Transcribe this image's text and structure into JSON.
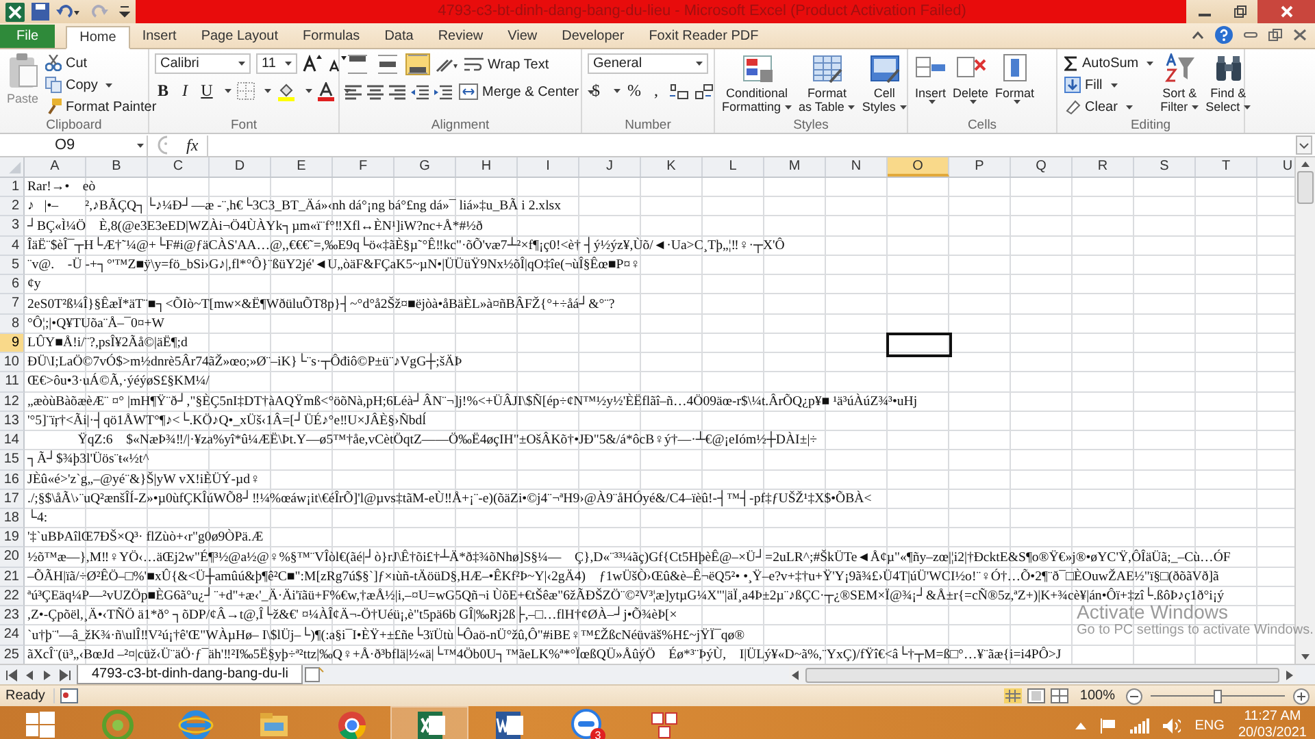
{
  "window": {
    "title": "4793-c3-bt-dinh-dang-bang-du-lieu  -  Microsoft Excel (Product Activation Failed)"
  },
  "ribbon_tabs": [
    {
      "label": "File",
      "kind": "file",
      "selected": false
    },
    {
      "label": "Home",
      "kind": "tab",
      "selected": true
    },
    {
      "label": "Insert",
      "kind": "tab",
      "selected": false
    },
    {
      "label": "Page Layout",
      "kind": "tab",
      "selected": false
    },
    {
      "label": "Formulas",
      "kind": "tab",
      "selected": false
    },
    {
      "label": "Data",
      "kind": "tab",
      "selected": false
    },
    {
      "label": "Review",
      "kind": "tab",
      "selected": false
    },
    {
      "label": "View",
      "kind": "tab",
      "selected": false
    },
    {
      "label": "Developer",
      "kind": "tab",
      "selected": false
    },
    {
      "label": "Foxit Reader PDF",
      "kind": "tab",
      "selected": false
    }
  ],
  "clipboard": {
    "label": "Clipboard",
    "paste": "Paste",
    "cut": "Cut",
    "copy": "Copy",
    "format_painter": "Format Painter"
  },
  "font": {
    "label": "Font",
    "name": "Calibri",
    "size": "11",
    "bold": "B",
    "italic": "I",
    "underline": "U"
  },
  "alignment": {
    "label": "Alignment",
    "wrap_text": "Wrap Text",
    "merge_center": "Merge & Center",
    "vertical_align": [
      {
        "selected": false
      },
      {
        "selected": false
      },
      {
        "selected": true
      }
    ]
  },
  "number": {
    "label": "Number",
    "format": "General",
    "currency": "$",
    "percent": "%",
    "comma": ","
  },
  "styles": {
    "label": "Styles",
    "buttons": [
      {
        "line1": "Conditional",
        "line2": "Formatting"
      },
      {
        "line1": "Format",
        "line2": "as Table"
      },
      {
        "line1": "Cell",
        "line2": "Styles"
      }
    ]
  },
  "cells": {
    "label": "Cells",
    "buttons": [
      "Insert",
      "Delete",
      "Format"
    ]
  },
  "editing": {
    "label": "Editing",
    "autosum": "AutoSum",
    "fill": "Fill",
    "clear": "Clear",
    "sort_filter": {
      "line1": "Sort &",
      "line2": "Filter"
    },
    "find_select": {
      "line1": "Find &",
      "line2": "Select"
    }
  },
  "formula_bar": {
    "name_box": "O9",
    "function_label": "fx"
  },
  "columns": [
    {
      "label": "A",
      "selected": false
    },
    {
      "label": "B",
      "selected": false
    },
    {
      "label": "C",
      "selected": false
    },
    {
      "label": "D",
      "selected": false
    },
    {
      "label": "E",
      "selected": false
    },
    {
      "label": "F",
      "selected": false
    },
    {
      "label": "G",
      "selected": false
    },
    {
      "label": "H",
      "selected": false
    },
    {
      "label": "I",
      "selected": false
    },
    {
      "label": "J",
      "selected": false
    },
    {
      "label": "K",
      "selected": false
    },
    {
      "label": "L",
      "selected": false
    },
    {
      "label": "M",
      "selected": false
    },
    {
      "label": "N",
      "selected": false
    },
    {
      "label": "O",
      "selected": true
    },
    {
      "label": "P",
      "selected": false
    },
    {
      "label": "Q",
      "selected": false
    },
    {
      "label": "R",
      "selected": false
    },
    {
      "label": "S",
      "selected": false
    },
    {
      "label": "T",
      "selected": false
    },
    {
      "label": "U",
      "selected": false
    }
  ],
  "rows": [
    {
      "number": "1",
      "selected": false,
      "text": "Rar!→•    eò"
    },
    {
      "number": "2",
      "selected": false,
      "text": "♪   |•–        ²,♪BÃÇQ┐└♪¼Ð┘—æ -¨,h€└3C3_BT_Äá»‹nh dá°¡ng bá°£ng dá»¯ liá»‡u_BÃ i 2.xlsx"
    },
    {
      "number": "3",
      "selected": false,
      "text": "┘BÇ«Ì¼Ö    È,8(@e3E3eED|WZÀi¬Ö4ÙÀYk┐µm«ï¨f°‼Xfl↔ÈN¹]iW?nc+Å*#½ð"
    },
    {
      "number": "4",
      "selected": false,
      "text": "ÎäË¨$èÎ¯┬H└Æ†˜¼@+└F#i@ƒäCÀS'AA…@,,€€€˜=,‰E9q└ö«‡ãÈ§µ˜°Ê‼kc\"·õÕ'væ7┴²×f¶¡ç0!<è† ┤ý½ýz¥,Ùõ/◄·Ua>C¸Tþ„¦‼♀·┬X'Ô"
    },
    {
      "number": "5",
      "selected": false,
      "text": "¨v@.    -Ü -+┐°'™Z■ÿ\\y=fö_bSi›G♪|,fl*°Ô}¨ßüY2jé'◄U„òäF&FÇaK5~µN•|ÜÜüŸ9Nx½õÎ|qO‡îe(¬ùÎ§Êœ■P¤♀"
    },
    {
      "number": "6",
      "selected": false,
      "text": "¢y"
    },
    {
      "number": "7",
      "selected": false,
      "text": "2eS0T²ß¼Î}§ÊæÏ*äT¨■┐<ÕIò~T[mw×&Ë¶WðüluÕT8p}┤~°d°å2Šž¤■ëjòà•åBäÈL»à¤ñBÂFŽ{°+÷åá┘&°¨?"
    },
    {
      "number": "8",
      "selected": false,
      "text": "°Ô¦;|•Q¥TUõa¨Å–¯0¤+W"
    },
    {
      "number": "9",
      "selected": true,
      "text": "LÛY■Å!i/¨?,psÎ¥2Ãå©|äË¶;d"
    },
    {
      "number": "10",
      "selected": false,
      "text": "ÐÜ\\I;LaÖ©7vÓ$>m½dnrè5Âr74ãŽ»œo;»Ø¨–iK}└¨s·┬Ôđiô©P±ü¨♪VgG┼;šÄÞ"
    },
    {
      "number": "11",
      "selected": false,
      "text": "Œ€>ôu•3·uÁ©Ã,·ýéýøS£§KM¼/"
    },
    {
      "number": "12",
      "selected": false,
      "text": "„æòùBàõæèÆ¨ ¤° |mH¶Ÿ¨ð┘,\"§ÈÇ5nI‡DT†àAQŸmß<°öõNà,pH;6Léà┘ÂN¨¬]j!%<+ÜÂJI\\$Ñ[ép÷¢N™½y½'ÈËflãî–ñ…4Ö09äœ-r$\\¼t.ÂrÕQ¿p¥■ ¹ä³úÀúZ¾³•uHj"
    },
    {
      "number": "13",
      "selected": false,
      "text": "'°5]¨ïŗ†<Ãi|·┤qö1ÅWT°¶♪<└.KÖ♪Q•_xÜš‹1Â=[┘ÜÉ♪°e‼U×JÂÈ§›Ñbdĺ"
    },
    {
      "number": "14",
      "selected": false,
      "text": "               ŸqZ:6    $«NæÞ¾‼/|·¥za%yî*û¼ÆË\\Þt.Y—ø5™†åe,vCètÖqtZ——Ö‰Ë4øçIH\"±OšÂKõ†•JÐ\"5&/á*ôcB♀ý†—·┴€@¡eIóm½┼DÀI±|÷"
    },
    {
      "number": "15",
      "selected": false,
      "text": "┐Ã┘$¾þ3l'Üös¨ŧ«½t^"
    },
    {
      "number": "16",
      "selected": false,
      "text": "JÈû«é>'z`g„–@yé¨&}Š|yW vX!iÈÜÝ-µd♀"
    },
    {
      "number": "17",
      "selected": false,
      "text": "./;§$\\åÃ\\›¨uQ²ænšÎÍ-Z»•µ0ùfÇKÎúWÕ8┘‼¼%œáw¡it\\€éÎrÕ]'l@µvs‡tãM-eÙ‼Å+¡¨-e)(õäZi•©j4¨¬ªH9›@À9¨åHÓyé&/C4–ïèû!-┤™┤-pf‡ƒUŠŽ¹‡X$•ÕBÀ<"
    },
    {
      "number": "18",
      "selected": false,
      "text": "└4:"
    },
    {
      "number": "19",
      "selected": false,
      "text": "'‡`uBÞAîlŒ7ÐŠ×Q³· flZùò+‹r\"g0ø9ÒPä.Æ"
    },
    {
      "number": "20",
      "selected": false,
      "text": "½õ™æ—},M‼♀YÖ‹…äŒj2w\"É¶³½@a½@♀%§™¨VÎòl€(ãé|┘ò}rJ\\Ê†õi£†┴Ä*ð‡¾õNhø]S§¼—    Ç},D«¨³³¼ãç)Gf{Ct5HþèÊ@–×Ü┘=2uLR^;#ŠkÜTe◄Å¢µ\"«¶ñy–zœ|¦i2|†ÐcktE&S¶o®Ÿ€»j®•øYC'Ÿ,ÔÎäÜã;_–Cù…ÓF"
    },
    {
      "number": "21",
      "selected": false,
      "text": "–ÕÃH|ïã/÷Ø²ÊÖ–□%'■xÛ{&<Ü┼amûú&þ¶ê²C■\":M[zRg7ú$§`]ƒ×ıùñ-tÄöüD§,HÆ–•ÊKf²Þ~Y|‹2gÄ4)    ƒ1wÜšÒ›Œû&è–Ê¬ëQ5²• •¸Ÿ–e?v+‡†u+Ÿ'Y¡9ã¾£›Ü4T|úÜ'WCI½o!¨♀Ó†…Õ•2¶¨ð¯□ÈOuwŽAE½\"ï§□(ðõãVð]ã"
    },
    {
      "number": "22",
      "selected": false,
      "text": "ªú³ÇEäq¼P—²vUZÖp■ÈG6ã°u¿┘¨+d\"+æ‹'_Ä·Äi'ïãü+F%€w,†æÅ½|i,–¤U=wG5Qñ¬i ÙõE+€tŠêæ\"6žÃÐŠZÖ¨©²V³¦æ]ytµG¼X\"'|äÏ¸a4Þ±2µ¨♪ßÇC·┬¿®SEM×Ï@¾¡┘&Å±r{=cÑ®5z,ªZ+)|K+¾cè¥|án•Ôï+‡zî└.ßôÞ♪ç1ð°i¡ý"
    },
    {
      "number": "23",
      "selected": false,
      "text": ",Z•-Çpõël,¸Ä•‹TÑÖ ä1*ð° ┐õDP/¢Â→t@,Î└ž&€' ¤¼ÀÎ¢Ä¬-Ö†Uéü¡,è\"t5pä6b GÎ|‰Rj2ß├,–□…flH†¢ØÀ–┘j•Õ¾èÞ[×"
    },
    {
      "number": "24",
      "selected": false,
      "text": "`u†þ¨'—â_žK¾·ñ\\ulÎ‼V²ú¡†ê'Œ\"WÀµHø– I\\$lÜj–└)¶(:a§i¯I•ÈŸ+±£ñe└3ïÜtù└Ôaö-nÜ°žû,Ô\"#iBE♀™£ŽßcNéüväš%H£~jŸÏ¯qø®"
    },
    {
      "number": "25",
      "selected": false,
      "text": "ãXcÎ¨(ü³„‹BœJd –²¤|cüž‹Ü¨äÖ·ƒ¯äh'‼²I‰5Ë§yþ÷ª²ttz|‰Q♀+Å·ð³bflä|½«ä|└™4Öb0U┐™ãeLK%ª*°ÏœßQÜ»ÅûýÖ    Éø*³¨ÞýÙ,    I|ÜLý¥«D~ã%,¨YxÇ)/fŸî€<â└†┬M=ß□°…¥¨ãæ{i=i4PÔ>J"
    }
  ],
  "sheet_tabs": [
    {
      "label": "4793-c3-bt-dinh-dang-bang-du-li",
      "selected": true
    }
  ],
  "activation_notice": {
    "title": "Activate Windows",
    "subtitle": "Go to PC settings to activate Windows."
  },
  "status_bar": {
    "status": "Ready",
    "zoom": "100%",
    "level": 0.5
  },
  "taskbar": {
    "apps": [
      {
        "kind": "start",
        "selected": false
      },
      {
        "kind": "green",
        "selected": false
      },
      {
        "kind": "ie",
        "selected": false
      },
      {
        "kind": "explorer",
        "selected": false
      },
      {
        "kind": "chrome",
        "selected": false
      },
      {
        "kind": "excel",
        "selected": true
      },
      {
        "kind": "word",
        "selected": false
      },
      {
        "kind": "zalo",
        "selected": false,
        "badge": "3"
      },
      {
        "kind": "grid",
        "selected": false
      }
    ],
    "language": "ENG",
    "time": "11:27 AM",
    "date": "20/03/2021"
  }
}
